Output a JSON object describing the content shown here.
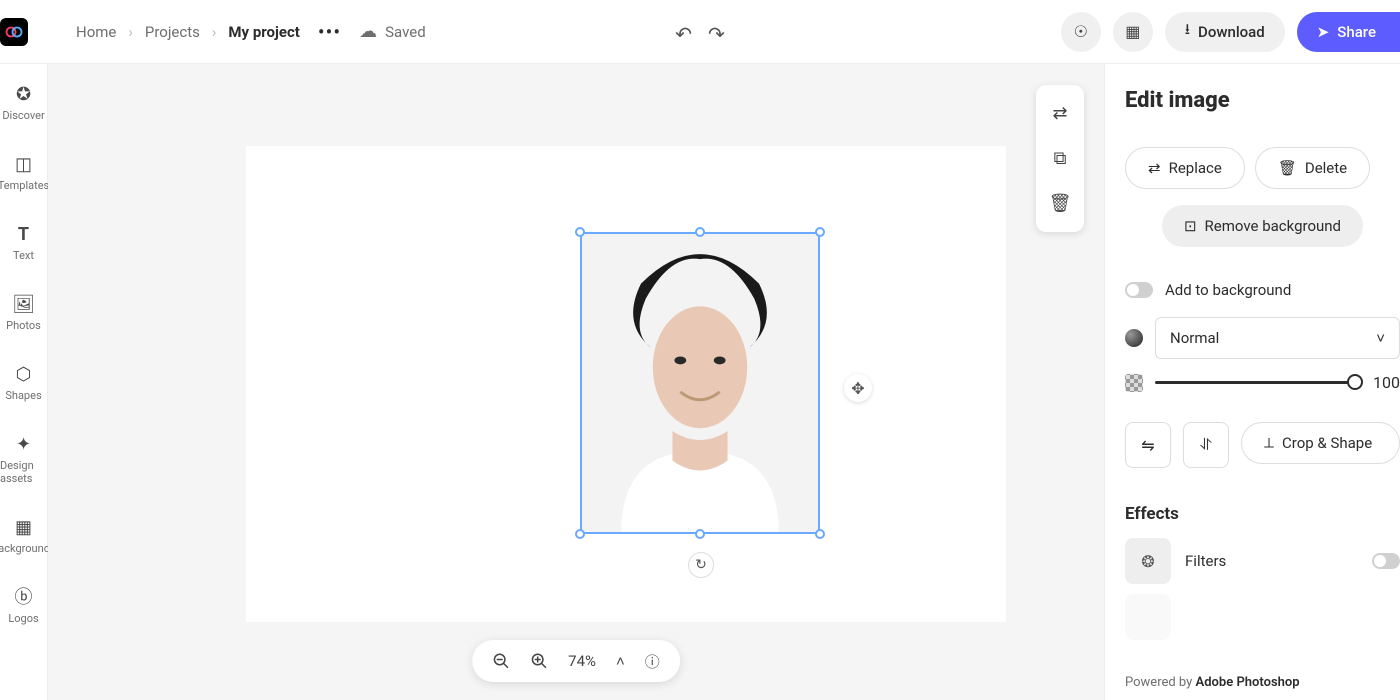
{
  "breadcrumb": {
    "home": "Home",
    "projects": "Projects",
    "current": "My project"
  },
  "saved_label": "Saved",
  "top_actions": {
    "download": "Download",
    "share": "Share"
  },
  "sidebar": [
    {
      "label": "Discover"
    },
    {
      "label": "Templates"
    },
    {
      "label": "Text"
    },
    {
      "label": "Photos"
    },
    {
      "label": "Shapes"
    },
    {
      "label": "Design assets"
    },
    {
      "label": "Backgrounds"
    },
    {
      "label": "Logos"
    }
  ],
  "zoom": {
    "value": "74%"
  },
  "panel": {
    "title": "Edit image",
    "replace": "Replace",
    "delete": "Delete",
    "remove_bg": "Remove background",
    "add_to_bg": "Add to background",
    "blend_mode": "Normal",
    "opacity": "100",
    "crop": "Crop & Shape",
    "effects_title": "Effects",
    "filters": "Filters",
    "footer_prefix": "Powered by ",
    "footer_brand": "Adobe Photoshop"
  }
}
